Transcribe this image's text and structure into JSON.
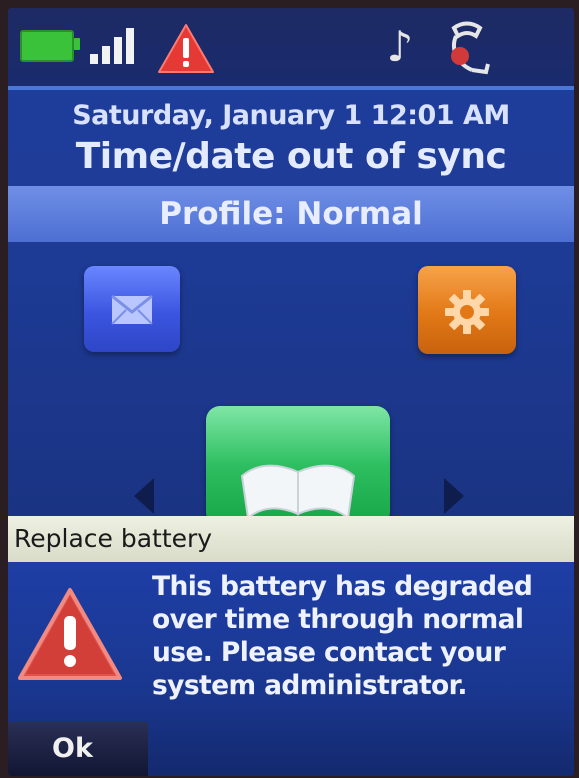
{
  "status_bar": {
    "icons": [
      "battery-full-icon",
      "signal-strength-icon",
      "warning-icon",
      "music-note-icon",
      "handset-icon"
    ],
    "colors": {
      "battery": "#3bc23b",
      "warning": "#e53935"
    }
  },
  "header": {
    "date_time": "Saturday, January 1 12:01 AM",
    "sync_status": "Time/date out of sync"
  },
  "profile": {
    "label": "Profile: Normal"
  },
  "home_tiles": [
    {
      "name": "messages",
      "icon": "envelope-icon",
      "color": "#3b55e0"
    },
    {
      "name": "settings",
      "icon": "gear-icon",
      "color": "#e27816"
    },
    {
      "name": "directory",
      "icon": "book-icon",
      "color": "#2dbe60"
    }
  ],
  "notice": {
    "title": "Replace battery",
    "message": "This battery has degraded\nover time through normal\nuse.  Please contact your\nsystem administrator.",
    "ok_label": "Ok"
  }
}
